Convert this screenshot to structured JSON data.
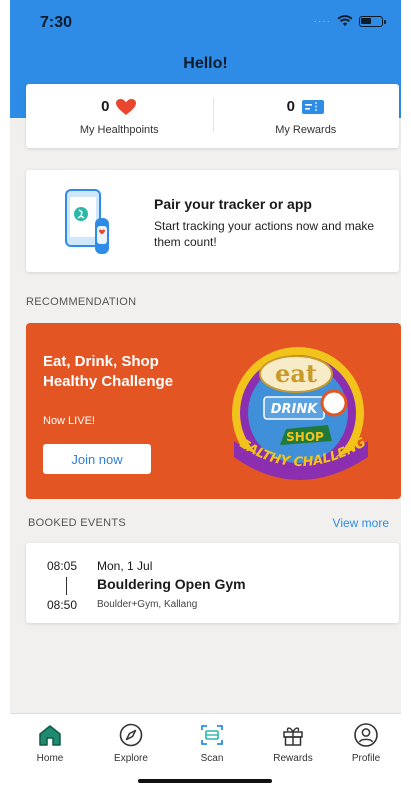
{
  "status_bar": {
    "time": "7:30",
    "signal_dots": "····"
  },
  "header": {
    "greeting": "Hello!"
  },
  "stats": {
    "healthpoints": {
      "value": "0",
      "label": "My Healthpoints"
    },
    "rewards": {
      "value": "0",
      "label": "My Rewards"
    }
  },
  "pair_card": {
    "title": "Pair your tracker or app",
    "subtitle": "Start tracking your actions now and make them count!"
  },
  "recommendation": {
    "section_label": "RECOMMENDATION",
    "title": "Eat, Drink, Shop Healthy Challenge",
    "subtitle": "Now LIVE!",
    "button_label": "Join now",
    "art_text": {
      "eat": "eat",
      "drink": "DRINK",
      "shop": "SHOP",
      "banner": "HEALTHY CHALLENGE"
    }
  },
  "booked_events": {
    "section_label": "BOOKED EVENTS",
    "view_more": "View more",
    "items": [
      {
        "start": "08:05",
        "end": "08:50",
        "date": "Mon, 1 Jul",
        "title": "Bouldering Open Gym",
        "location": "Boulder+Gym, Kallang"
      }
    ]
  },
  "nav": {
    "items": [
      {
        "label": "Home",
        "icon": "home-icon"
      },
      {
        "label": "Explore",
        "icon": "compass-icon"
      },
      {
        "label": "Scan",
        "icon": "scan-icon"
      },
      {
        "label": "Rewards",
        "icon": "gift-icon"
      },
      {
        "label": "Profile",
        "icon": "profile-icon"
      }
    ]
  },
  "colors": {
    "header_blue": "#2e8ce6",
    "promo_orange": "#e35522",
    "heart_red": "#e8472e",
    "link_blue": "#2e8ce6",
    "home_green": "#1f8a70",
    "scan_teal": "#2bb8a8"
  }
}
